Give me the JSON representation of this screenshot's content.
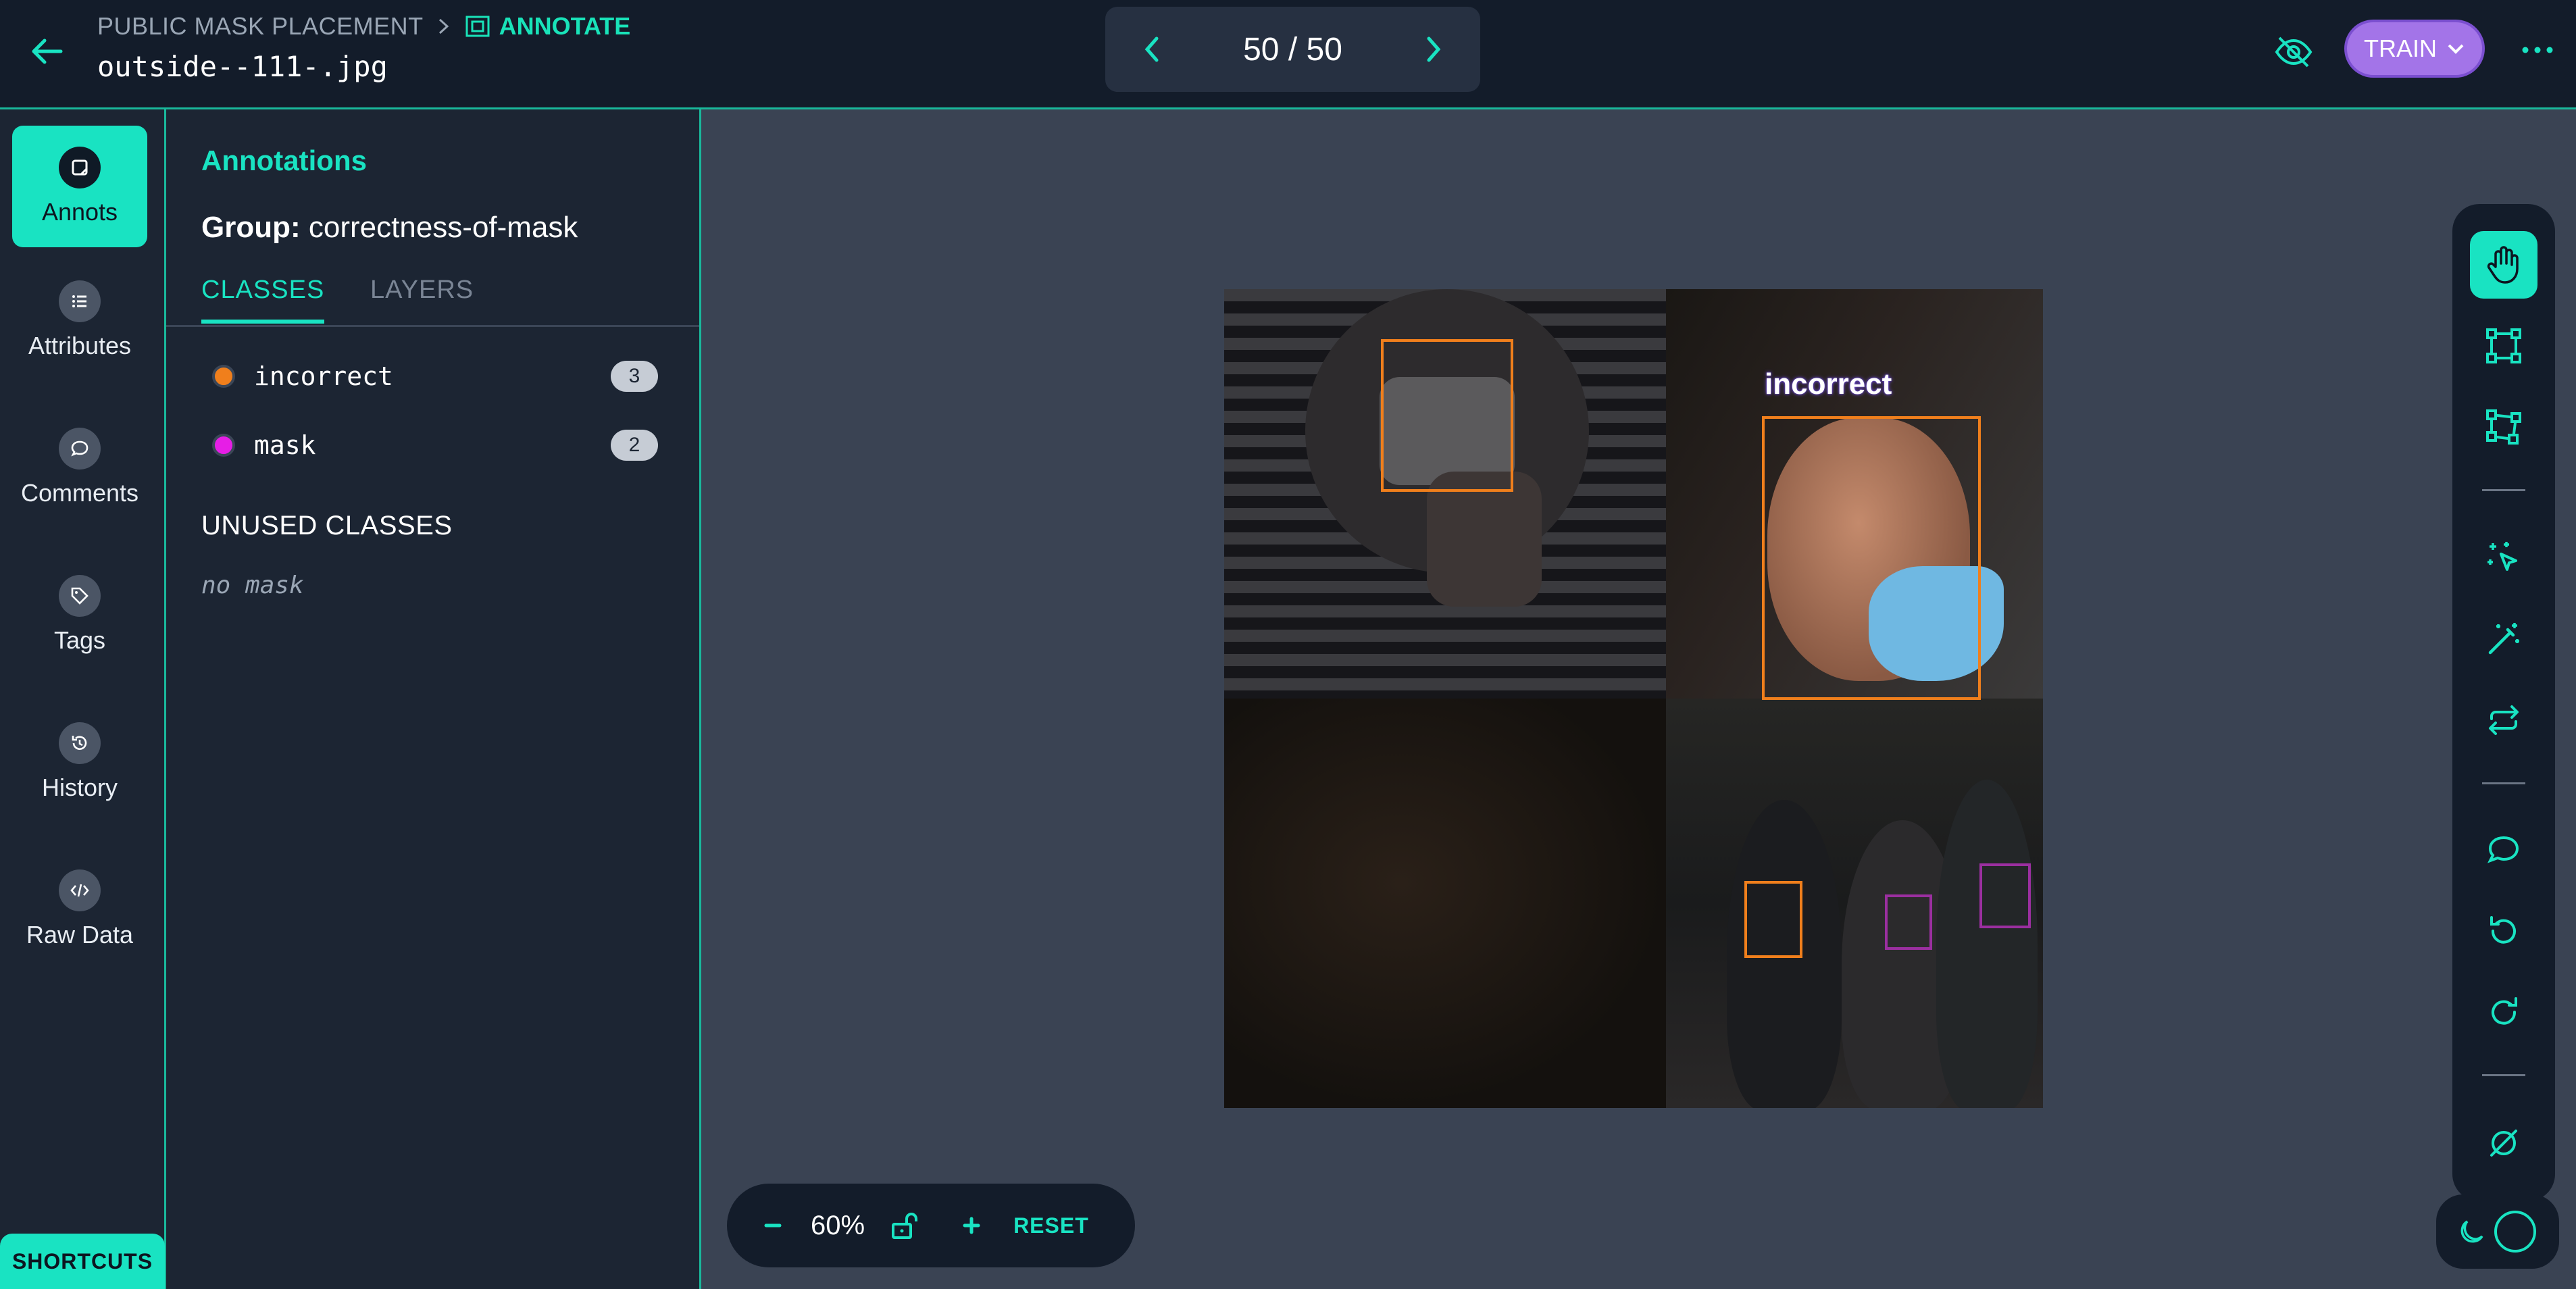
{
  "header": {
    "project": "PUBLIC MASK PLACEMENT",
    "current_step": "ANNOTATE",
    "filename": "outside--111-.jpg",
    "pager": "50 / 50",
    "train_label": "TRAIN"
  },
  "nav": {
    "items": [
      {
        "label": "Annots",
        "icon": "annotation-icon"
      },
      {
        "label": "Attributes",
        "icon": "list-icon"
      },
      {
        "label": "Comments",
        "icon": "comment-icon"
      },
      {
        "label": "Tags",
        "icon": "tag-icon"
      },
      {
        "label": "History",
        "icon": "history-icon"
      },
      {
        "label": "Raw Data",
        "icon": "code-icon"
      }
    ],
    "shortcuts_label": "SHORTCUTS"
  },
  "panel": {
    "title": "Annotations",
    "group_label": "Group:",
    "group_value": "correctness-of-mask",
    "tabs": [
      "CLASSES",
      "LAYERS"
    ],
    "classes": [
      {
        "name": "incorrect",
        "count": "3",
        "color": "#f07f1c"
      },
      {
        "name": "mask",
        "count": "2",
        "color": "#e61ee6"
      }
    ],
    "unused_title": "UNUSED CLASSES",
    "unused": [
      "no mask"
    ]
  },
  "canvas": {
    "visible_label": "incorrect"
  },
  "zoom": {
    "value": "60%",
    "reset_label": "RESET"
  },
  "colors": {
    "accent": "#19e3c2",
    "train": "#a374e8",
    "incorrect": "#f07f1c",
    "mask": "#9b2fa0"
  }
}
